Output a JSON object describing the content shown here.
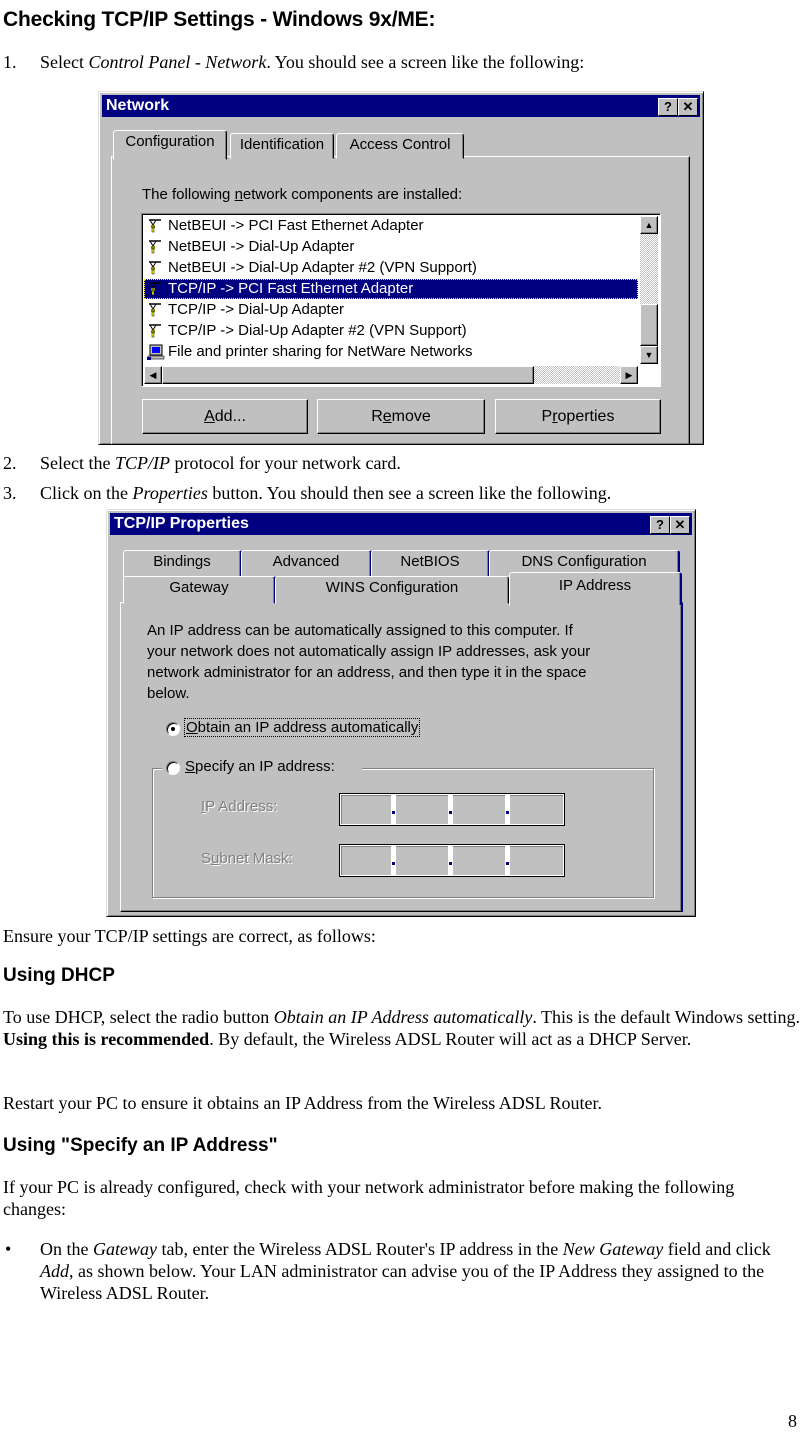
{
  "heading": "Checking TCP/IP Settings - Windows 9x/ME:",
  "steps": [
    {
      "num": "1.",
      "pre": "Select ",
      "em": "Control Panel - Network",
      "post": ". You should see a screen like the following:"
    },
    {
      "num": "2.",
      "pre": "Select the ",
      "em": "TCP/IP",
      "post": " protocol for your network card."
    },
    {
      "num": "3.",
      "pre": "Click on the ",
      "em": "Properties",
      "post": " button. You should then see a screen like the following."
    }
  ],
  "network_dialog": {
    "title": "Network",
    "help_label": "?",
    "close_label": "✕",
    "tabs": [
      "Configuration",
      "Identification",
      "Access Control"
    ],
    "active_tab": "Configuration",
    "list_label_pre": "The following ",
    "list_label_u": "n",
    "list_label_post": "etwork components are installed:",
    "components": [
      {
        "label": "NetBEUI -> PCI Fast Ethernet Adapter",
        "icon": "protocol-icon",
        "selected": false
      },
      {
        "label": "NetBEUI -> Dial-Up Adapter",
        "icon": "protocol-icon",
        "selected": false
      },
      {
        "label": "NetBEUI -> Dial-Up Adapter #2 (VPN Support)",
        "icon": "protocol-icon",
        "selected": false
      },
      {
        "label": "TCP/IP -> PCI Fast Ethernet Adapter",
        "icon": "protocol-icon",
        "selected": true
      },
      {
        "label": "TCP/IP -> Dial-Up Adapter",
        "icon": "protocol-icon",
        "selected": false
      },
      {
        "label": "TCP/IP -> Dial-Up Adapter #2 (VPN Support)",
        "icon": "protocol-icon",
        "selected": false
      },
      {
        "label": "File and printer sharing for NetWare Networks",
        "icon": "computer-icon",
        "selected": false
      }
    ],
    "buttons": {
      "add": {
        "u": "A",
        "rest": "dd..."
      },
      "remove": {
        "pre": "R",
        "u": "e",
        "rest": "move"
      },
      "properties": {
        "pre": "P",
        "u": "r",
        "rest": "operties"
      }
    }
  },
  "tcpip_dialog": {
    "title": "TCP/IP Properties",
    "help_label": "?",
    "close_label": "✕",
    "tabs_row1": [
      "Bindings",
      "Advanced",
      "NetBIOS",
      "DNS Configuration"
    ],
    "tabs_row2": [
      "Gateway",
      "WINS Configuration",
      "IP Address"
    ],
    "active_tab": "IP Address",
    "description_lines": [
      "An IP address can be automatically assigned to this computer.  If",
      "your network does not automatically assign IP addresses, ask your",
      "network administrator for an address, and then type it in the space",
      "below."
    ],
    "radio_auto": {
      "u": "O",
      "rest": "btain an IP address automatically",
      "checked": true
    },
    "radio_specify": {
      "u": "S",
      "rest": "pecify an IP address:",
      "checked": false
    },
    "ip_address_label": {
      "u": "I",
      "rest": "P Address:"
    },
    "subnet_mask_label": {
      "pre": "S",
      "u": "u",
      "rest": "bnet Mask:"
    },
    "ip_address_value": [
      "",
      "",
      "",
      ""
    ],
    "subnet_mask_value": [
      "",
      "",
      "",
      ""
    ]
  },
  "ensure_text": "Ensure your TCP/IP settings are correct, as follows:",
  "dhcp": {
    "heading": "Using DHCP",
    "p1_a": "To use DHCP, select the radio button ",
    "p1_em": "Obtain an IP Address automatically",
    "p1_b": ". This is the default Windows setting. ",
    "p1_strong": "Using this is recommended",
    "p1_c": ". By default, the Wireless ADSL Router will act as a DHCP Server.",
    "p2": "Restart your PC to ensure it obtains an IP Address from the Wireless ADSL Router."
  },
  "specify": {
    "heading": "Using \"Specify an IP Address\"",
    "p1": "If your PC is already configured, check with your network administrator before making the following changes:",
    "bullet": "•",
    "b1_a": "On the ",
    "b1_em1": "Gateway",
    "b1_b": " tab, enter the Wireless ADSL Router's IP address in the ",
    "b1_em2": "New Gateway",
    "b1_c": " field and click ",
    "b1_em3": "Add",
    "b1_d": ", as shown below. Your LAN administrator can advise you of the IP Address they assigned to the Wireless ADSL Router."
  },
  "page_number": "8"
}
